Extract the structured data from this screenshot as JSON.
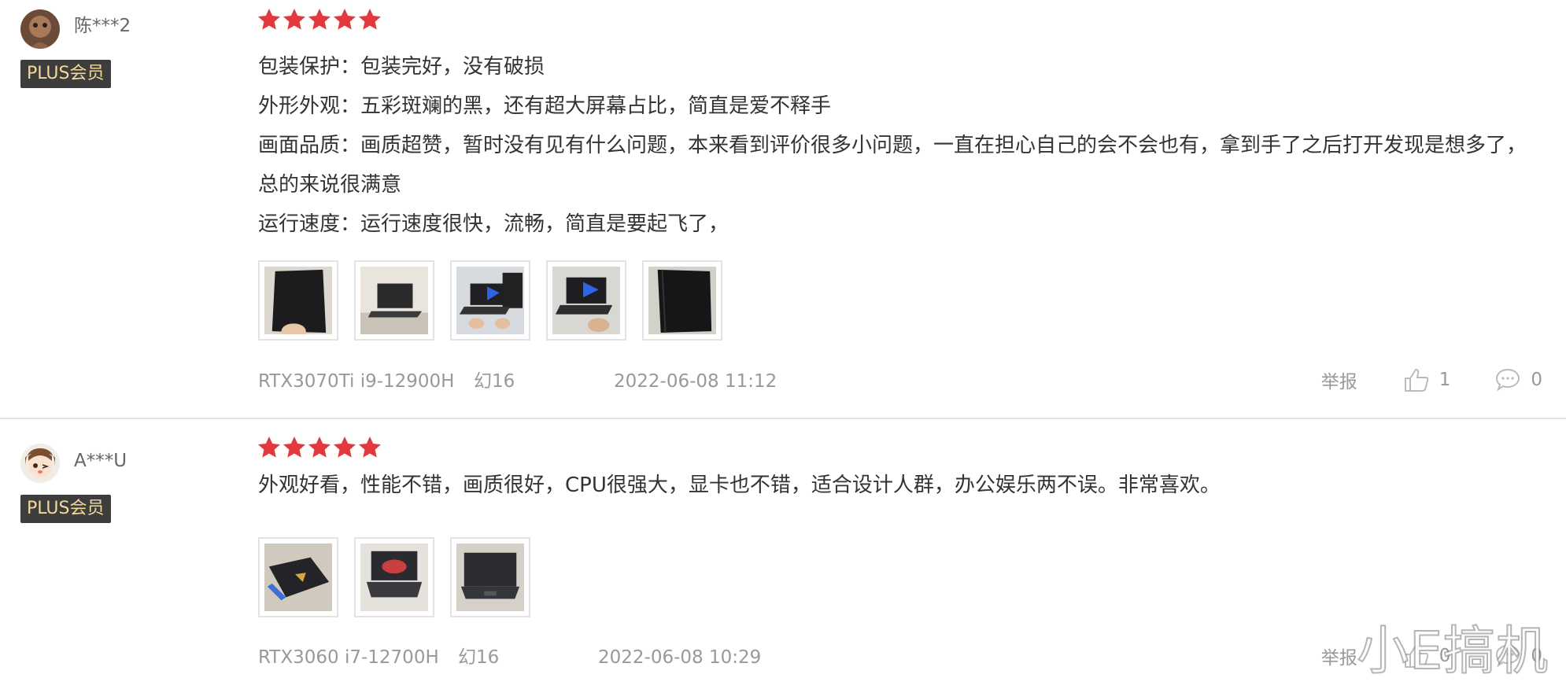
{
  "reviews": [
    {
      "username": "陈***2",
      "badge": "PLUS会员",
      "rating": 5,
      "lines": [
        "包装保护：包装完好，没有破损",
        "外形外观：五彩斑斓的黑，还有超大屏幕占比，简直是爱不释手",
        "画面品质：画质超赞，暂时没有见有什么问题，本来看到评价很多小问题，一直在担心自己的会不会也有，拿到手了之后打开发现是想多了，总的来说很满意",
        "运行速度：运行速度很快，流畅，简直是要起飞了，"
      ],
      "image_count": 5,
      "spec": "RTX3070Ti i9-12900H",
      "model": "幻16",
      "date": "2022-06-08 11:12",
      "report_label": "举报",
      "likes": "1",
      "comments": "0"
    },
    {
      "username": "A***U",
      "badge": "PLUS会员",
      "rating": 5,
      "lines": [
        "外观好看，性能不错，画质很好，CPU很强大，显卡也不错，适合设计人群，办公娱乐两不误。非常喜欢。"
      ],
      "image_count": 3,
      "spec": "RTX3060 i7-12700H",
      "model": "幻16",
      "date": "2022-06-08 10:29",
      "report_label": "举报",
      "likes": "0",
      "comments": "0"
    }
  ],
  "watermark": "小E搞机",
  "colors": {
    "star": "#e4393c",
    "badge_bg": "#3d3d3d",
    "badge_text": "#f3d99a",
    "meta": "#999999"
  }
}
